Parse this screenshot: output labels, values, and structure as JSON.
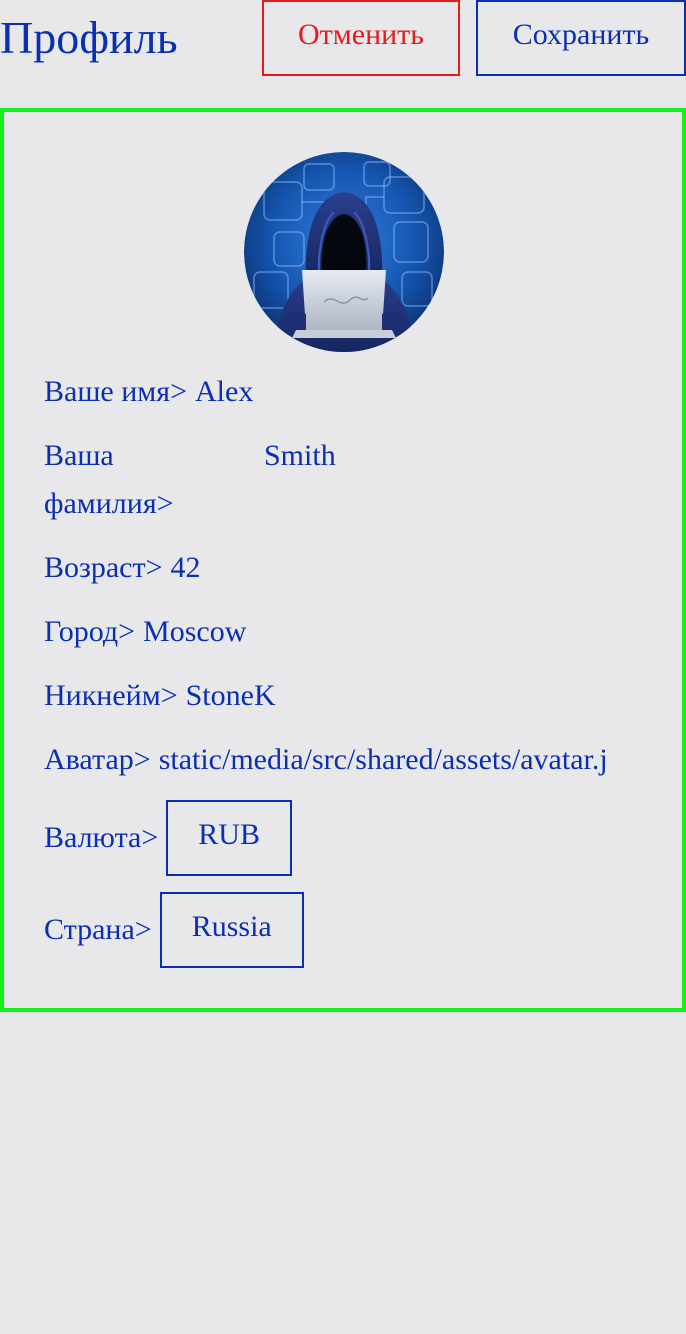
{
  "header": {
    "title": "Профиль",
    "cancel_label": "Отменить",
    "save_label": "Сохранить"
  },
  "colors": {
    "text_blue": "#0a2fb3",
    "cancel_red": "#e51c1c",
    "card_border_green": "#17f01a",
    "background": "#e8e8ea"
  },
  "profile": {
    "avatar_icon": "hacker-avatar-icon",
    "fields": {
      "first_name": {
        "label": "Ваше имя>",
        "value": "Alex"
      },
      "last_name": {
        "label": "Ваша фамилия>",
        "value": "Smith"
      },
      "age": {
        "label": "Возраст>",
        "value": "42"
      },
      "city": {
        "label": "Город>",
        "value": "Moscow"
      },
      "nickname": {
        "label": "Никнейм>",
        "value": "StoneK"
      },
      "avatar": {
        "label": "Аватар>",
        "value": "static/media/src/shared/assets/avatar.j"
      },
      "currency": {
        "label": "Валюта>",
        "value": "RUB"
      },
      "country": {
        "label": "Страна>",
        "value": "Russia"
      }
    }
  }
}
